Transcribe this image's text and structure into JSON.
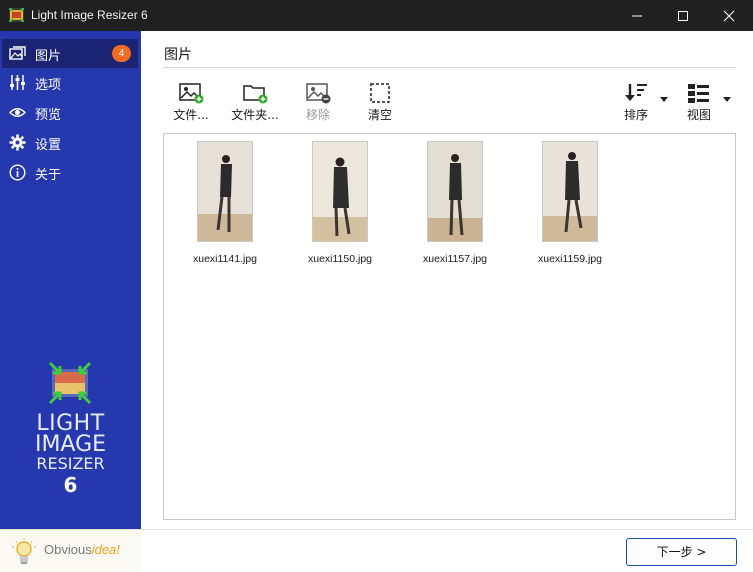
{
  "window": {
    "title": "Light Image Resizer 6"
  },
  "sidebar": {
    "items": [
      {
        "label": "图片",
        "icon": "images-icon",
        "badge": "4",
        "active": true
      },
      {
        "label": "选项",
        "icon": "sliders-icon"
      },
      {
        "label": "预览",
        "icon": "eye-icon"
      },
      {
        "label": "设置",
        "icon": "gear-icon"
      },
      {
        "label": "关于",
        "icon": "info-icon"
      }
    ],
    "logo": {
      "line1": "LIGHT",
      "line2": "IMAGE",
      "line3": "RESIZER",
      "version": "6"
    },
    "brand": {
      "part1": "Obvious",
      "part2": "idea!"
    }
  },
  "main": {
    "title": "图片",
    "toolbar": {
      "add_files": "文件...",
      "add_folder": "文件夹...",
      "remove": "移除",
      "clear": "清空",
      "sort": "排序",
      "view": "视图"
    },
    "files": [
      {
        "name": "xuexi1141.jpg"
      },
      {
        "name": "xuexi1150.jpg"
      },
      {
        "name": "xuexi1157.jpg"
      },
      {
        "name": "xuexi1159.jpg"
      }
    ],
    "next_button": "下一步 >"
  },
  "colors": {
    "sidebar_bg": "#2638ad",
    "sidebar_active": "#1a2473",
    "badge": "#f26b21",
    "titlebar": "#202020",
    "accent_green": "#2fa52f"
  }
}
